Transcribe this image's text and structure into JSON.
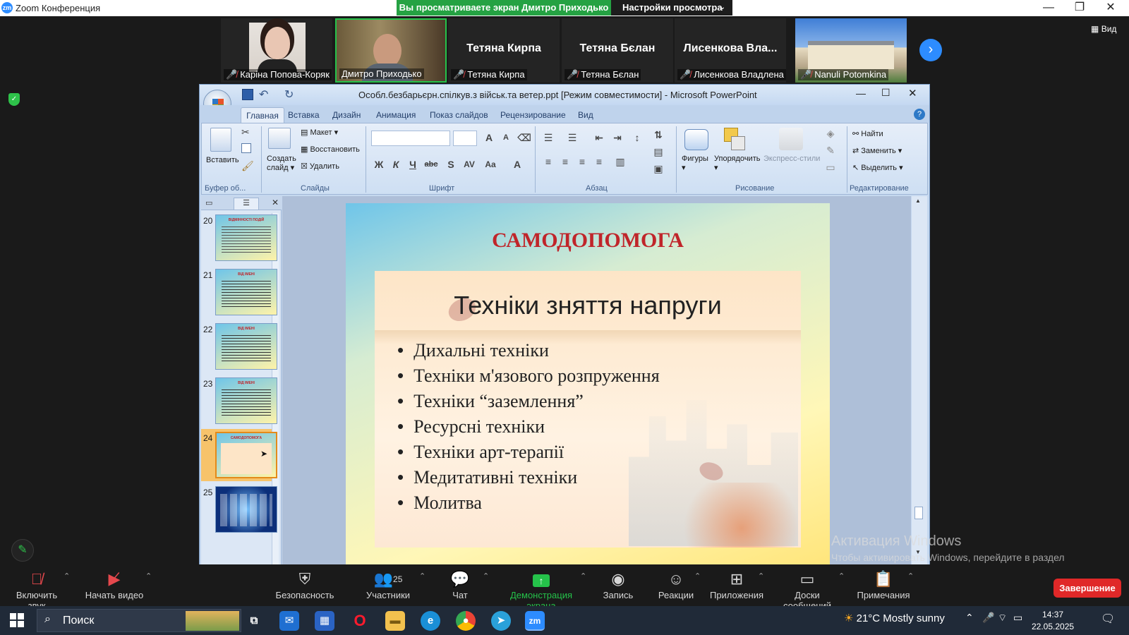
{
  "zoom": {
    "app_title": "Zoom Конференция",
    "share_banner": "Вы просматриваете экран Дмитро Приходько",
    "view_settings": "Настройки просмотра",
    "view_label": "Вид",
    "participants": [
      {
        "label": "Каріна Попова-Коряк",
        "muted": true,
        "video": true
      },
      {
        "label": "Дмитро Приходько",
        "muted": false,
        "video": true
      },
      {
        "label": "Тетяна Кирпа",
        "display": "Тетяна Кирпа",
        "muted": true,
        "video": false
      },
      {
        "label": "Тетяна Бєлан",
        "display": "Тетяна Бєлан",
        "muted": true,
        "video": false
      },
      {
        "label": "Лисенкова Владлена",
        "display": "Лисенкова Вла...",
        "muted": true,
        "video": false
      },
      {
        "label": "Nanuli Potomkina",
        "muted": true,
        "video": true
      }
    ],
    "toolbar": {
      "unmute": "Включить звук",
      "start_video": "Начать видео",
      "security": "Безопасность",
      "participants": "Участники",
      "participants_count": "25",
      "chat": "Чат",
      "share": "Демонстрация экрана",
      "record": "Запись",
      "reactions": "Реакции",
      "apps": "Приложения",
      "whiteboards": "Доски сообщений",
      "notes": "Примечания",
      "end": "Завершение"
    },
    "watermark_title": "Активация Windows",
    "watermark_text": "Чтобы активировать Windows, перейдите в раздел \"Параметры\"."
  },
  "ppt": {
    "title": "Особл.безбарьєрн.спілкув.з військ.та ветер.ppt [Режим совместимости] - Microsoft PowerPoint",
    "tabs": [
      "Главная",
      "Вставка",
      "Дизайн",
      "Анимация",
      "Показ слайдов",
      "Рецензирование",
      "Вид"
    ],
    "groups": {
      "clipboard": "Буфер об...",
      "slides": "Слайды",
      "font": "Шрифт",
      "paragraph": "Абзац",
      "drawing": "Рисование",
      "editing": "Редактирование"
    },
    "buttons": {
      "paste": "Вставить",
      "new_slide_1": "Создать",
      "new_slide_2": "слайд",
      "layout": "Макет",
      "reset": "Восстановить",
      "delete": "Удалить",
      "shapes": "Фигуры",
      "arrange": "Упорядочить",
      "quick_styles": "Экспресс-стили",
      "find": "Найти",
      "replace": "Заменить",
      "select": "Выделить"
    },
    "thumbnails": [
      {
        "num": "20",
        "title": "ВІДМІННОСТІ ПОДІЙ"
      },
      {
        "num": "21",
        "title": "ВІД ІМЕНІ"
      },
      {
        "num": "22",
        "title": "ВІД ІМЕНІ"
      },
      {
        "num": "23",
        "title": "ВІД ІМЕНІ"
      },
      {
        "num": "24",
        "title": "САМОДОПОМОГА"
      },
      {
        "num": "25",
        "title": ""
      }
    ],
    "slide": {
      "title": "САМОДОПОМОГА",
      "heading": "Техніки зняття напруги",
      "items": [
        "Дихальні техніки",
        "Техніки м'язового розпруження",
        "Техніки “заземлення”",
        "Ресурсні техніки",
        "Техніки арт-терапії",
        "Медитативні техніки",
        "Молитва"
      ]
    }
  },
  "taskbar": {
    "search_placeholder": "Поиск",
    "weather": "21°C  Mostly sunny",
    "time": "14:37",
    "date": "22.05.2025"
  }
}
